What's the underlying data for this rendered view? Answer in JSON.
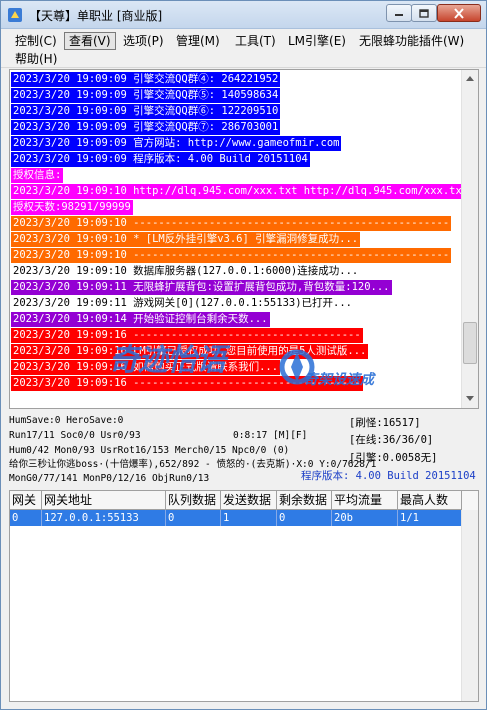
{
  "window": {
    "title": "【天尊】单职业 [商业版]"
  },
  "menu": {
    "items": [
      {
        "label": "控制(C)"
      },
      {
        "label": "查看(V)"
      },
      {
        "label": "选项(P)"
      },
      {
        "label": "管理(M)"
      },
      {
        "label": "工具(T)"
      },
      {
        "label": "LM引擎(E)"
      },
      {
        "label": "无限蜂功能插件(W)"
      },
      {
        "label": "帮助(H)"
      }
    ]
  },
  "log": {
    "lines": [
      {
        "text": "2023/3/20 19:09:09 引擎交流QQ群④: 264221952",
        "bg": "#0000ff",
        "fg": "#ffffff"
      },
      {
        "text": "2023/3/20 19:09:09 引擎交流QQ群⑤: 140598634",
        "bg": "#0000ff",
        "fg": "#ffffff"
      },
      {
        "text": "2023/3/20 19:09:09 引擎交流QQ群⑥: 122209510",
        "bg": "#0000ff",
        "fg": "#ffffff"
      },
      {
        "text": "2023/3/20 19:09:09 引擎交流QQ群⑦: 286703001",
        "bg": "#0000ff",
        "fg": "#ffffff"
      },
      {
        "text": "2023/3/20 19:09:09 官方网站: http://www.gameofmir.com",
        "bg": "#0000ff",
        "fg": "#ffffff"
      },
      {
        "text": "2023/3/20 19:09:09 程序版本: 4.00 Build 20151104",
        "bg": "#0000ff",
        "fg": "#ffffff"
      },
      {
        "text": "授权信息:",
        "bg": "#ff00ff",
        "fg": "#ffffff"
      },
      {
        "text": "2023/3/20 19:09:10 http://dlq.945.com/xxx.txt http://dlq.945.com/xxx.txt",
        "bg": "#ff00ff",
        "fg": "#ffffff"
      },
      {
        "text": "授权天数:98291/99999",
        "bg": "#ff00ff",
        "fg": "#ffffff"
      },
      {
        "text": "2023/3/20 19:09:10 --------------------------------------------------",
        "bg": "#ff6a00",
        "fg": "#ffffff"
      },
      {
        "text": "2023/3/20 19:09:10 * [LM反外挂引擎v3.6] 引擎漏洞修复成功...",
        "bg": "#ff6a00",
        "fg": "#ffffff"
      },
      {
        "text": "2023/3/20 19:09:10 --------------------------------------------------",
        "bg": "#ff6a00",
        "fg": "#ffffff"
      },
      {
        "text": "2023/3/20 19:09:10 数据库服务器(127.0.0.1:6000)连接成功...",
        "bg": "#ffffff",
        "fg": "#000000"
      },
      {
        "text": "2023/3/20 19:09:11 无限蜂扩展背包:设置扩展背包成功,背包数量:120...",
        "bg": "#9400d3",
        "fg": "#ffffff"
      },
      {
        "text": "2023/3/20 19:09:11 游戏网关[0](127.0.0.1:55133)已打开...",
        "bg": "#ffffff",
        "fg": "#000000"
      },
      {
        "text": "2023/3/20 19:09:14 开始验证控制台剩余天数...",
        "bg": "#9400d3",
        "fg": "#ffffff"
      },
      {
        "text": "2023/3/20 19:09:16 ------------------------------------",
        "bg": "#ff0000",
        "fg": "#ffffff"
      },
      {
        "text": "2023/3/20 19:09:16 LM引擎已授权成功,您目前使用的是5人测试版...",
        "bg": "#ff0000",
        "fg": "#ffffff"
      },
      {
        "text": "2023/3/20 19:09:16 如需购买正式版请联系我们...",
        "bg": "#ff0000",
        "fg": "#ffffff"
      },
      {
        "text": "2023/3/20 19:09:16 ------------------------------------",
        "bg": "#ff0000",
        "fg": "#ffffff"
      }
    ]
  },
  "watermark": {
    "main": "奇迹怡语",
    "sub": "奇架设速成"
  },
  "status": {
    "line1": "HumSave:0 HeroSave:0",
    "line2": "Run17/11 Soc0/0 Usr0/93",
    "line2_time": "0:8:17 [M][F]",
    "line3": "Hum0/42 Mon0/93 UsrRot16/153 Merch0/15 Npc0/0 (0)",
    "line4": "给你三秒让你逃boss·(十倍爆率),652/892 - 愤怒的·(去克斯)·X:0 Y:0/7628/1",
    "line5": "MonG0/77/141 MonP0/12/16 ObjRun0/13",
    "refresh": "[刷怪:16517]",
    "online": "[在线:36/36/0]",
    "engine": "[引擎:0.0058无]",
    "version": "程序版本: 4.00 Build 20151104"
  },
  "table": {
    "headers": [
      "网关",
      "网关地址",
      "队列数据",
      "发送数据",
      "剩余数据",
      "平均流量",
      "最高人数"
    ],
    "rows": [
      [
        "0",
        "127.0.0.1:55133",
        "0",
        "1",
        "0",
        "20b",
        "1/1"
      ]
    ]
  },
  "colors": {
    "selection": "#2f7be5",
    "status_blue": "#1c3fc7",
    "watermark": "#2a6fd6"
  }
}
